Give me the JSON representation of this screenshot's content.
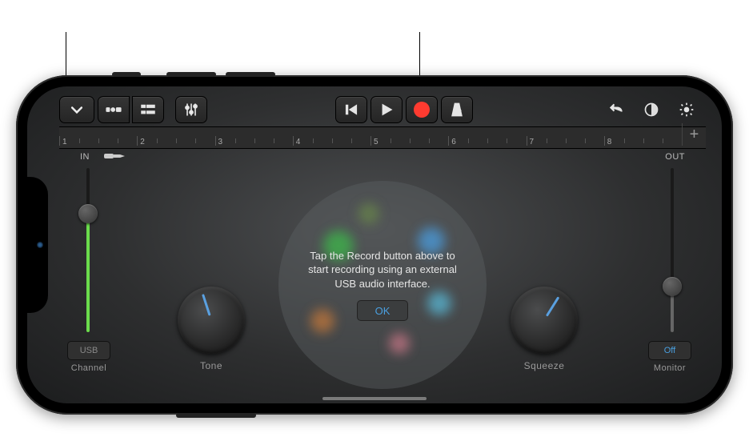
{
  "toolbar": {
    "browser_icon": "chevron-down",
    "view_icon": "track-view",
    "mixer_icon": "mixer",
    "eq_icon": "sliders",
    "rewind_icon": "skip-back",
    "play_icon": "play",
    "record_icon": "record",
    "metronome_icon": "metronome",
    "undo_icon": "undo",
    "autoplay_icon": "auto-adjust",
    "settings_icon": "gear"
  },
  "ruler": {
    "bars": [
      "1",
      "2",
      "3",
      "4",
      "5",
      "6",
      "7",
      "8"
    ],
    "add_label": "+"
  },
  "input": {
    "label": "IN",
    "plug_icon": "jack-plug",
    "level_pct": 72,
    "channel_value": "USB",
    "channel_label": "Channel"
  },
  "tone": {
    "label": "Tone"
  },
  "squeeze": {
    "label": "Squeeze"
  },
  "output": {
    "label": "OUT",
    "level_pct": 28,
    "monitor_value": "Off",
    "monitor_label": "Monitor"
  },
  "hint": {
    "text": "Tap the Record button above to start recording using an external USB audio interface.",
    "ok": "OK"
  }
}
